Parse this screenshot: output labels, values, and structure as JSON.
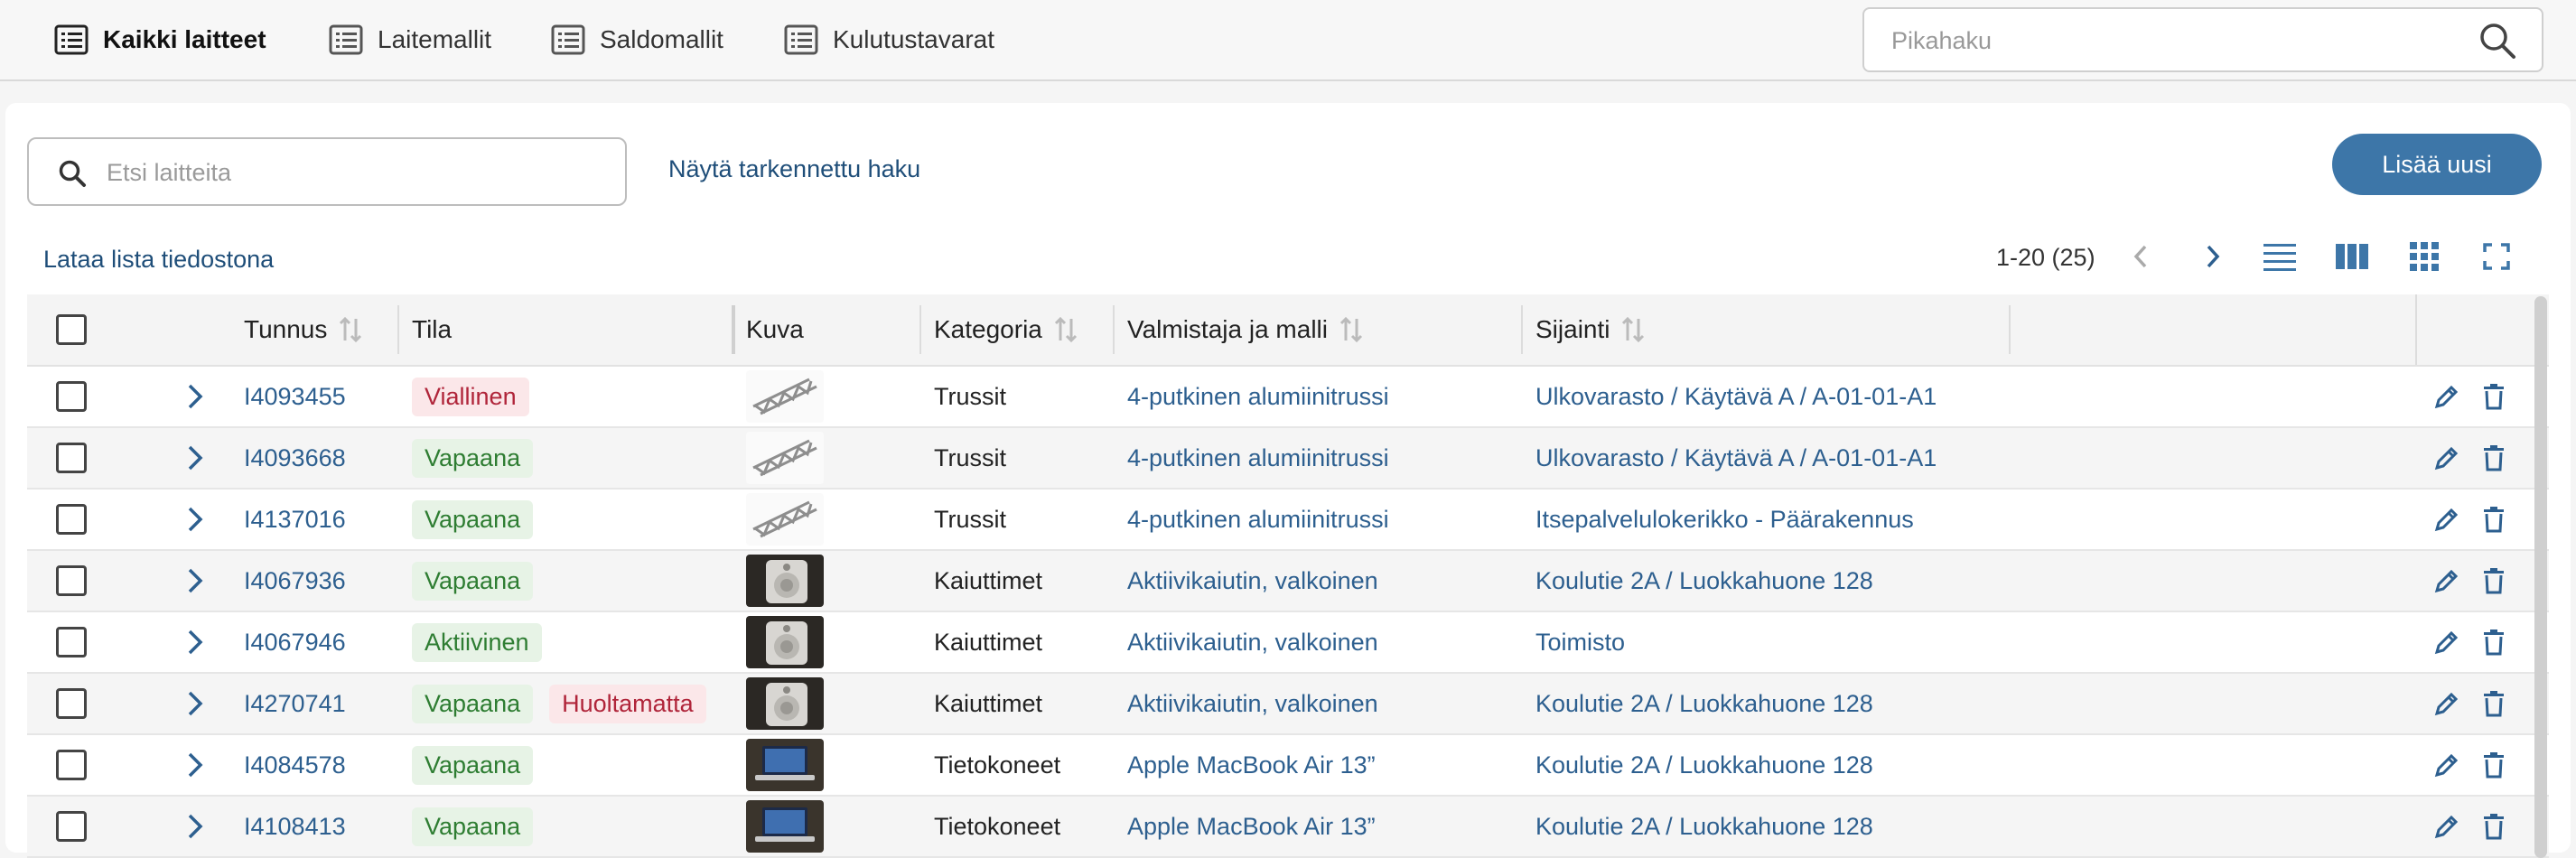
{
  "nav": {
    "tabs": [
      {
        "label": "Kaikki laitteet",
        "active": true
      },
      {
        "label": "Laitemallit"
      },
      {
        "label": "Saldomallit"
      },
      {
        "label": "Kulutustavarat"
      }
    ],
    "quick_search_placeholder": "Pikahaku"
  },
  "toolbar": {
    "search_placeholder": "Etsi laitteita",
    "advanced_search": "Näytä tarkennettu haku",
    "add_new": "Lisää uusi",
    "download_list": "Lataa lista tiedostona",
    "paging": "1-20 (25)"
  },
  "table": {
    "columns": [
      "Tunnus",
      "Tila",
      "Kuva",
      "Kategoria",
      "Valmistaja ja malli",
      "Sijainti"
    ],
    "rows": [
      {
        "id": "I4093455",
        "status": [
          "Viallinen"
        ],
        "image": "truss",
        "category": "Trussit",
        "model": "4-putkinen alumiinitrussi",
        "location": "Ulkovarasto / Käytävä A / A-01-01-A1"
      },
      {
        "id": "I4093668",
        "status": [
          "Vapaana"
        ],
        "image": "truss",
        "category": "Trussit",
        "model": "4-putkinen alumiinitrussi",
        "location": "Ulkovarasto / Käytävä A / A-01-01-A1"
      },
      {
        "id": "I4137016",
        "status": [
          "Vapaana"
        ],
        "image": "truss",
        "category": "Trussit",
        "model": "4-putkinen alumiinitrussi",
        "location": "Itsepalvelulokerikko - Päärakennus"
      },
      {
        "id": "I4067936",
        "status": [
          "Vapaana"
        ],
        "image": "speaker",
        "category": "Kaiuttimet",
        "model": "Aktiivikaiutin, valkoinen",
        "location": "Koulutie 2A / Luokkahuone 128"
      },
      {
        "id": "I4067946",
        "status": [
          "Aktiivinen"
        ],
        "image": "speaker",
        "category": "Kaiuttimet",
        "model": "Aktiivikaiutin, valkoinen",
        "location": "Toimisto"
      },
      {
        "id": "I4270741",
        "status": [
          "Vapaana",
          "Huoltamatta"
        ],
        "image": "speaker",
        "category": "Kaiuttimet",
        "model": "Aktiivikaiutin, valkoinen",
        "location": "Koulutie 2A / Luokkahuone 128"
      },
      {
        "id": "I4084578",
        "status": [
          "Vapaana"
        ],
        "image": "laptop",
        "category": "Tietokoneet",
        "model": "Apple MacBook Air 13”",
        "location": "Koulutie 2A / Luokkahuone 128"
      },
      {
        "id": "I4108413",
        "status": [
          "Vapaana"
        ],
        "image": "laptop",
        "category": "Tietokoneet",
        "model": "Apple MacBook Air 13”",
        "location": "Koulutie 2A / Luokkahuone 128"
      }
    ]
  },
  "colors": {
    "accent": "#3d76a8",
    "link": "#2d5f8f",
    "ok": "#2e7d32",
    "error": "#b0253a"
  }
}
